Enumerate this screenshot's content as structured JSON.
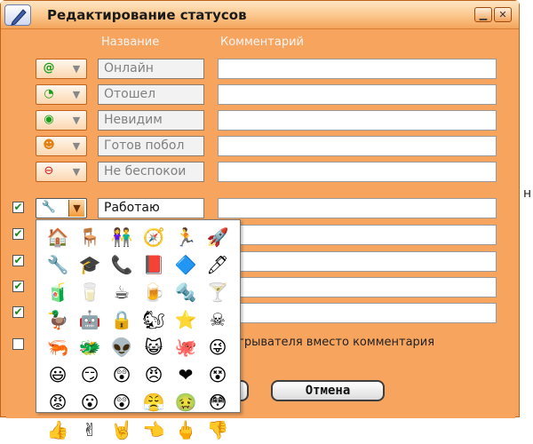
{
  "window": {
    "title": "Редактирование статусов"
  },
  "columns": {
    "name": "Название",
    "comment": "Комментарий"
  },
  "statuses": [
    {
      "glyph": "@",
      "color": "#1a9e1a",
      "name": "Онлайн",
      "comment": "",
      "checkbox": false
    },
    {
      "glyph": "◔",
      "color": "#1a9e1a",
      "name": "Отошел",
      "comment": "",
      "checkbox": false
    },
    {
      "glyph": "◉",
      "color": "#1a9e1a",
      "name": "Невидим",
      "comment": "",
      "checkbox": false
    },
    {
      "glyph": "☻",
      "color": "#e08010",
      "name": "Готов побол",
      "comment": "",
      "checkbox": false
    },
    {
      "glyph": "⊖",
      "color": "#d02020",
      "name": "Не беспокои",
      "comment": "",
      "checkbox": false
    }
  ],
  "custom_statuses": [
    {
      "checked": true,
      "name": "Работаю",
      "comment": ""
    },
    {
      "checked": true,
      "name": "",
      "comment": ""
    },
    {
      "checked": true,
      "name": "",
      "comment": ""
    },
    {
      "checked": true,
      "name": "",
      "comment": ""
    },
    {
      "checked": true,
      "name": "",
      "comment": ""
    }
  ],
  "footer": {
    "option_label": "грывателя вместо комментария",
    "cancel_label": "Отмена"
  },
  "icon_picker": {
    "icons": [
      "🏠",
      "🪑",
      "👫",
      "🧭",
      "🏃",
      "🚀",
      "",
      "🔧",
      "🎓",
      "📞",
      "📕",
      "🔷",
      "🖊",
      "",
      "🧃",
      "🥛",
      "☕",
      "🍺",
      "🔩",
      "🍸",
      "",
      "🦆",
      "🤖",
      "🔒",
      "🐿",
      "⭐",
      "☠",
      "",
      "🦐",
      "🐲",
      "👽",
      "😺",
      "🐙",
      "😜",
      "",
      "😃",
      "😏",
      "😲",
      "😠",
      "❤",
      "😵",
      "",
      "😡",
      "😮",
      "😲",
      "😤",
      "🤢",
      "😳",
      "",
      "👍",
      "✌",
      "🤘",
      "👈",
      "🖕",
      "👎",
      ""
    ]
  }
}
